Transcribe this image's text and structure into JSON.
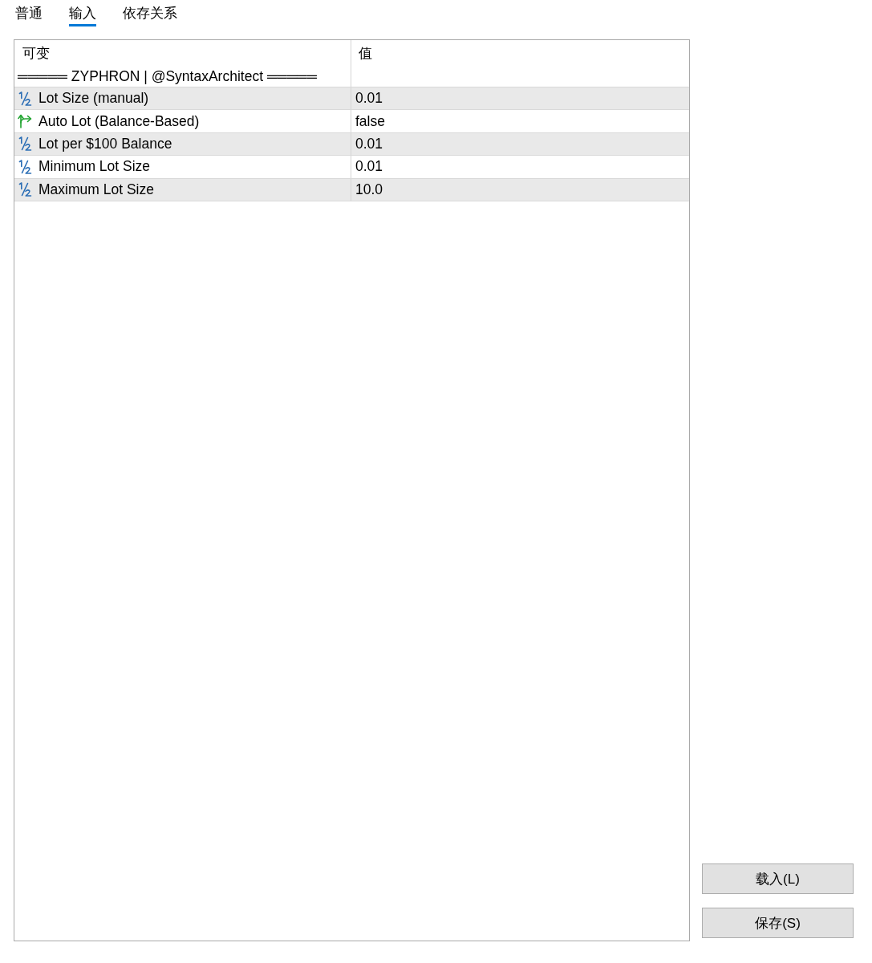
{
  "tabs": [
    {
      "label": "普通",
      "selected": false
    },
    {
      "label": "输入",
      "selected": true
    },
    {
      "label": "依存关系",
      "selected": false
    }
  ],
  "table": {
    "columns": [
      "可变",
      "值"
    ],
    "rows": [
      {
        "kind": "separator",
        "name": "═════ ZYPHRON | @SyntaxArchitect ═════"
      },
      {
        "kind": "double",
        "name": "Lot Size (manual)",
        "value": "0.01"
      },
      {
        "kind": "bool",
        "name": "Auto Lot (Balance-Based)",
        "value": "false"
      },
      {
        "kind": "double",
        "name": "Lot per $100 Balance",
        "value": "0.01"
      },
      {
        "kind": "double",
        "name": "Minimum Lot Size",
        "value": "0.01"
      },
      {
        "kind": "double",
        "name": "Maximum Lot Size",
        "value": "10.0"
      }
    ]
  },
  "buttons": [
    "载入(L)",
    "保存(S)"
  ]
}
